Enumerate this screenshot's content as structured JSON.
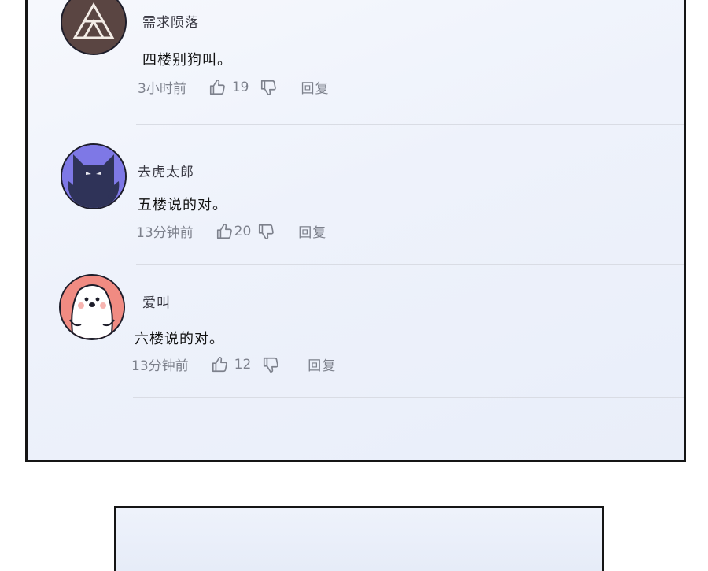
{
  "comments": [
    {
      "username": "需求陨落",
      "text": "四楼别狗叫。",
      "time": "3小时前",
      "likes": "19",
      "reply_label": "回复",
      "avatar_icon": "triangle-avatar"
    },
    {
      "username": "去虎太郎",
      "text": "五楼说的对。",
      "time": "13分钟前",
      "likes": "20",
      "reply_label": "回复",
      "avatar_icon": "dark-cat-avatar"
    },
    {
      "username": "爱叫",
      "text": "六楼说的对。",
      "time": "13分钟前",
      "likes": "12",
      "reply_label": "回复",
      "avatar_icon": "white-dog-avatar"
    }
  ],
  "colors": {
    "panel_border": "#151515",
    "meta_text": "#7d818c",
    "avatar1_bg": "#5a4542",
    "avatar2_bg": "#7e78e6",
    "avatar3_bg": "#f08b82"
  }
}
